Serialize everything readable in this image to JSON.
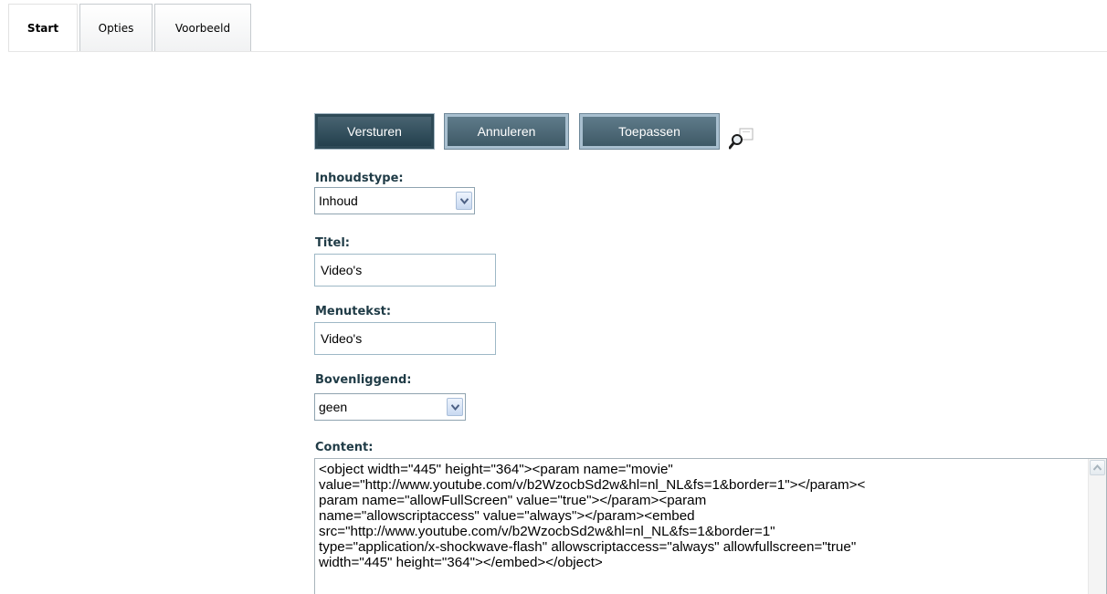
{
  "tabs": [
    {
      "label": "Start",
      "active": true
    },
    {
      "label": "Opties",
      "active": false
    },
    {
      "label": "Voorbeeld",
      "active": false
    }
  ],
  "toolbar": {
    "submit_label": "Versturen",
    "cancel_label": "Annuleren",
    "apply_label": "Toepassen"
  },
  "form": {
    "content_type": {
      "label": "Inhoudstype:",
      "value": "Inhoud"
    },
    "title": {
      "label": "Titel:",
      "value": "Video's"
    },
    "menu_text": {
      "label": "Menutekst:",
      "value": "Video's"
    },
    "parent": {
      "label": "Bovenliggend:",
      "value": "geen"
    },
    "content": {
      "label": "Content:",
      "value": "<object width=\"445\" height=\"364\"><param name=\"movie\" value=\"http://www.youtube.com/v/b2WzocbSd2w&hl=nl_NL&fs=1&border=1\"></param><param name=\"allowFullScreen\" value=\"true\"></param><param name=\"allowscriptaccess\" value=\"always\"></param><embed src=\"http://www.youtube.com/v/b2WzocbSd2w&hl=nl_NL&fs=1&border=1\" type=\"application/x-shockwave-flash\" allowscriptaccess=\"always\" allowfullscreen=\"true\" width=\"445\" height=\"364\"></embed></object>",
      "lines": [
        "<object width=\"445\" height=\"364\"><param name=\"movie\"",
        "value=\"http://www.youtube.com/v/b2WzocbSd2w&hl=nl_NL&fs=1&border=1\"></param><",
        "param name=\"allowFullScreen\" value=\"true\"></param><param",
        "name=\"allowscriptaccess\" value=\"always\"></param><embed",
        "src=\"http://www.youtube.com/v/b2WzocbSd2w&hl=nl_NL&fs=1&border=1\"",
        "type=\"application/x-shockwave-flash\" allowscriptaccess=\"always\" allowfullscreen=\"true\"",
        "width=\"445\" height=\"364\"></embed></object>"
      ]
    }
  },
  "icons": {
    "preview": "magnifier-icon",
    "dropdown": "chevron-down-icon",
    "scroll_up": "chevron-up-icon"
  },
  "colors": {
    "button_primary": "#2f4c59",
    "button": "#4b6775",
    "label": "#1f3b46"
  }
}
